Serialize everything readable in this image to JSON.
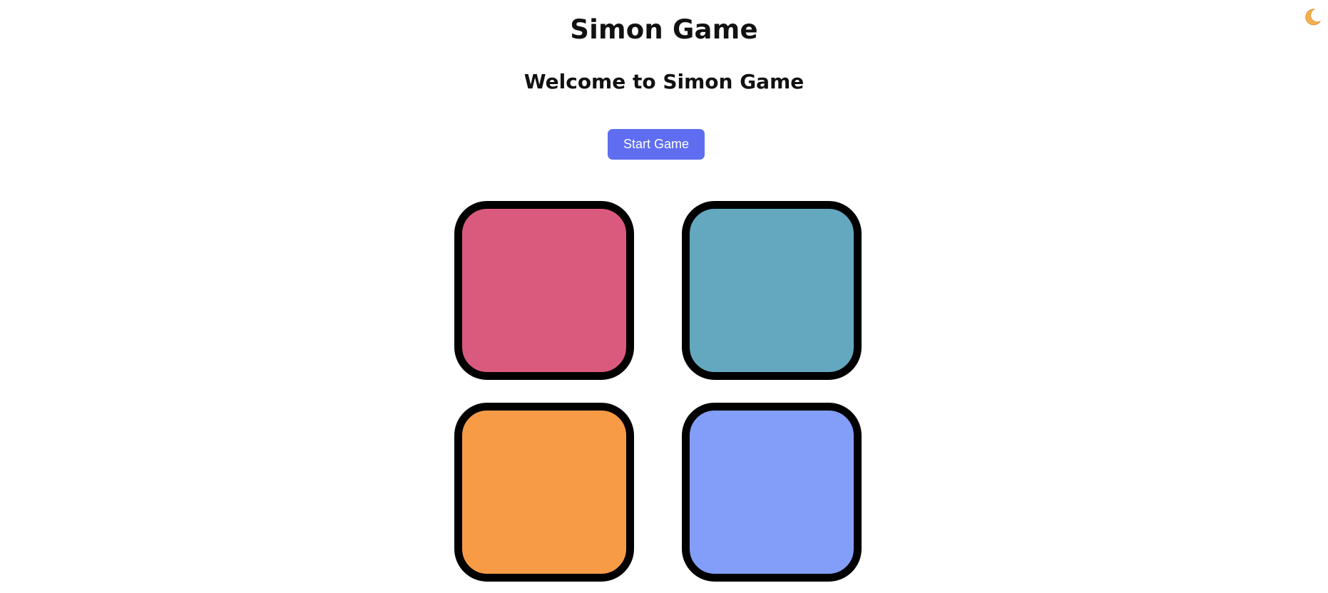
{
  "header": {
    "title": "Simon Game",
    "subtitle": "Welcome to Simon Game"
  },
  "controls": {
    "start_label": "Start Game",
    "theme_toggle_icon": "moon-icon"
  },
  "colors": {
    "button_accent": "#5f6ef0",
    "pad_red": "#da5a7d",
    "pad_teal": "#63a8bf",
    "pad_orange": "#f79b47",
    "pad_blue": "#829ef9",
    "pad_border": "#000000",
    "moon": "#f5b04e"
  },
  "pads": [
    {
      "id": "red",
      "color": "#da5a7d"
    },
    {
      "id": "teal",
      "color": "#63a8bf"
    },
    {
      "id": "orange",
      "color": "#f79b47"
    },
    {
      "id": "blue",
      "color": "#829ef9"
    }
  ]
}
